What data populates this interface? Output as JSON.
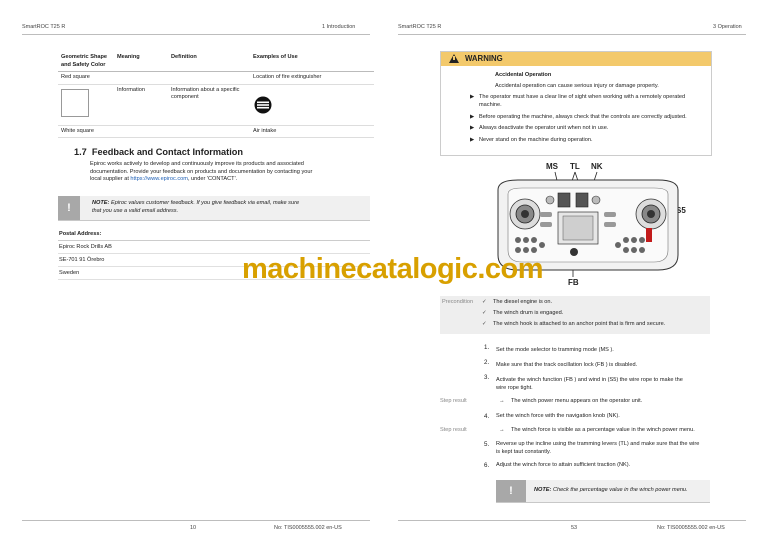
{
  "left_page": {
    "header_left": "SmartROC T25 R",
    "header_right": "1 Introduction",
    "table": {
      "headers": [
        "Geometric Shape and Safety Color",
        "Meaning",
        "Definition",
        "Examples of Use"
      ],
      "row1": {
        "shape": "Red square",
        "example": "Location of fire extinguisher"
      },
      "row2": {
        "meaning": "Information",
        "definition": "Information about a specific component",
        "shape": "White square",
        "example": "Air intake"
      }
    },
    "section_number": "1.7",
    "section_title": "Feedback and Contact Information",
    "body_line1": "Epiroc works actively to develop and continuously improve its products and associated",
    "body_line2": "documentation. Provide your feedback on products and documentation by contacting your",
    "body_line3_pre": "local supplier at ",
    "body_link": "https://www.epiroc.com",
    "body_line3_post": ", under 'CONTACT'.",
    "note_excl": "!",
    "note_label": "NOTE:",
    "note_line1": " Epiroc values customer feedback. If you give feedback via email, make sure",
    "note_line2": "that you use a valid email address.",
    "postal_title": "Postal Address:",
    "postal_lines": [
      "Epiroc Rock Drills AB",
      "SE-701 91 Örebro",
      "Sweden"
    ],
    "footer_page": "10",
    "footer_doc": "No: TIS0005555.002 en-US"
  },
  "right_page": {
    "header_left": "SmartROC T25 R",
    "header_right": "3 Operation",
    "warning_title": "WARNING",
    "warning_subtitle": "Accidental Operation",
    "warning_desc": "Accidental operation can cause serious injury or damage property.",
    "warning_bullets": [
      "The operator must have a clear line of sight when working with a remotely operated",
      "machine.",
      "Before operating the machine, always check that the controls are correctly adjusted.",
      "Always deactivate the operator unit when not in use.",
      "Never stand on the machine during operation."
    ],
    "figure_labels": {
      "ms": "MS",
      "tl": "TL",
      "nk": "NK",
      "s5": "S5",
      "fb": "FB"
    },
    "precondition_label": "Precondition",
    "preconditions": [
      "The diesel engine is on.",
      "The winch drum is engaged.",
      "The winch hook is attached to an anchor point that is firm and secure."
    ],
    "steps": [
      {
        "n": "1.",
        "text": "Set the mode selector to tramming mode (MS )."
      },
      {
        "n": "2.",
        "text": "Make sure that the track oscillation lock (FB ) is disabled."
      },
      {
        "n": "3.",
        "text": "Activate the winch function (FB ) and wind in (S5) the wire rope to make the",
        "text2": "wire rope tight."
      },
      {
        "n": "4.",
        "text": "Set the winch force with the navigation knob (NK)."
      },
      {
        "n": "5.",
        "text": "Reverse up the incline using the tramming levers (TL) and make sure that the wire",
        "text2": "is kept taut constantly."
      },
      {
        "n": "6.",
        "text": "Adjust the winch force to attain sufficient traction (NK)."
      }
    ],
    "step_result_label": "Step result",
    "step_results": [
      "The winch power menu appears on the operator unit.",
      "The winch force is visible as a percentage value in the winch power menu."
    ],
    "note_excl": "!",
    "note_label": "NOTE:",
    "note_text": " Check the percentage value in the winch power menu.",
    "footer_page": "53",
    "footer_doc": "No: TIS0005555.002 en-US"
  },
  "watermark": "machinecatalogic.com",
  "colors": {
    "warning_bg": "#f3c96b",
    "link": "#1d5fb5",
    "watermark": "#d8a000",
    "note_icon": "#a8a8a8"
  }
}
